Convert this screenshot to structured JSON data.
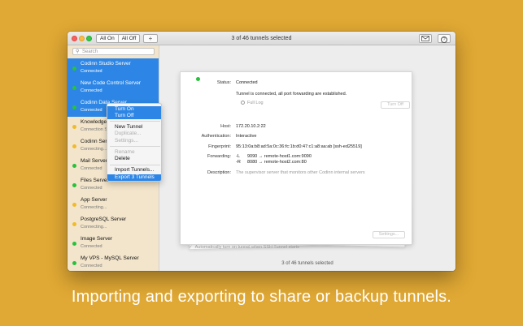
{
  "toolbar": {
    "all_on": "All On",
    "all_off": "All Off",
    "add": "+",
    "title": "3 of 46 tunnels selected",
    "mail_icon": "envelope-icon",
    "help": "?"
  },
  "search": {
    "placeholder": "Search",
    "icon": "magnifier-icon"
  },
  "sidebar": {
    "items": [
      {
        "name": "Codinn Studio Server",
        "status": "Connected",
        "state": "green",
        "selected": true
      },
      {
        "name": "New Code Control Server",
        "status": "Connected",
        "state": "green",
        "selected": true
      },
      {
        "name": "Codinn Data Server",
        "status": "Connected",
        "state": "green",
        "selected": true
      },
      {
        "name": "Knowledge B",
        "status": "Connection S",
        "state": "yellow",
        "selected": false
      },
      {
        "name": "Codinn Serv",
        "status": "Connecting...",
        "state": "yellow",
        "selected": false
      },
      {
        "name": "Mail Server",
        "status": "Connected",
        "state": "green",
        "selected": false
      },
      {
        "name": "Files Server",
        "status": "Connected",
        "state": "green",
        "selected": false
      },
      {
        "name": "App Server",
        "status": "Connecting...",
        "state": "yellow",
        "selected": false
      },
      {
        "name": "PostgreSQL Server",
        "status": "Connecting...",
        "state": "yellow",
        "selected": false
      },
      {
        "name": "Image Server",
        "status": "Connected",
        "state": "green",
        "selected": false
      },
      {
        "name": "My VPS - MySQL Server",
        "status": "Connected",
        "state": "green",
        "selected": false
      }
    ]
  },
  "context_menu": {
    "turn_on": "Turn On",
    "turn_off": "Turn Off",
    "new_tunnel": "New Tunnel",
    "duplicate": "Duplicate...",
    "settings": "Settings...",
    "rename": "Rename",
    "delete": "Delete",
    "import": "Import Tunnels...",
    "export": "Export 3 Tunnels"
  },
  "details": {
    "status_label": "Status:",
    "status_value": "Connected",
    "status_message": "Tunnel is connected, all port forwarding are established.",
    "full_log": "Full Log",
    "turn_off_button": "Turn Off",
    "host_label": "Host:",
    "host_value": "172.20.10.2:22",
    "auth_label": "Authentication:",
    "auth_value": "Interactive",
    "fingerprint_label": "Fingerprint:",
    "fingerprint_value": "95:13:0a:b8:ad:5a:0c:36:fc:1b:d0:47:c1:a8:aa:ab [ssh-ed25519]",
    "forwarding_label": "Forwarding:",
    "forwarding_1_flag": "-L",
    "forwarding_1": "9090 → remote-host1.com:9090",
    "forwarding_2_flag": "-R",
    "forwarding_2": "8080 → remote-host2.com:80",
    "description_label": "Description:",
    "description_value": "The supervisor server that monitors other Codinn internal servers",
    "auto_turn_on": "Automatically turn on tunnel when SSH Tunnel starts",
    "settings_button": "Settings..."
  },
  "footer": "3 of 46 tunnels selected",
  "caption": "Importing and exporting to share or backup tunnels."
}
